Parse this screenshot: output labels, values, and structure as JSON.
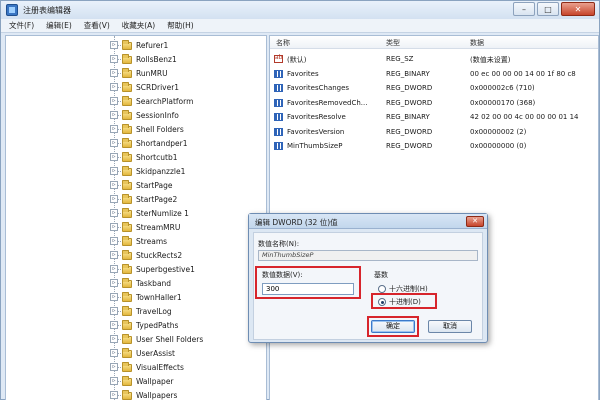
{
  "window": {
    "title": "注册表编辑器",
    "controls": {
      "minimize": "–",
      "maximize": "□",
      "close": "✕"
    }
  },
  "menu": [
    "文件(F)",
    "编辑(E)",
    "查看(V)",
    "收藏夹(A)",
    "帮助(H)"
  ],
  "tree": {
    "items": [
      "Refurer1",
      "RollsBenz1",
      "RunMRU",
      "SCRDriver1",
      "SearchPlatform",
      "SessionInfo",
      "Shell Folders",
      "Shortandper1",
      "Shortcutb1",
      "Skidpanzzle1",
      "StartPage",
      "StartPage2",
      "SterNumlize 1",
      "StreamMRU",
      "Streams",
      "StuckRects2",
      "Superbgestive1",
      "Taskband",
      "TownHaller1",
      "TravelLog",
      "TypedPaths",
      "User Shell Folders",
      "UserAssist",
      "VisualEffects",
      "Wallpaper",
      "Wallpapers"
    ]
  },
  "values": {
    "columns": {
      "name": "名称",
      "type": "类型",
      "data": "数据"
    },
    "rows": [
      {
        "name": "(默认)",
        "type": "REG_SZ",
        "data": "(数值未设置)",
        "icon": "string-value-icon"
      },
      {
        "name": "Favorites",
        "type": "REG_BINARY",
        "data": "00 ec 00 00 00 14 00 1f 80 c8",
        "icon": "binary-value-icon"
      },
      {
        "name": "FavoritesChanges",
        "type": "REG_DWORD",
        "data": "0x000002c6 (710)",
        "icon": "binary-value-icon"
      },
      {
        "name": "FavoritesRemovedCh...",
        "type": "REG_DWORD",
        "data": "0x00000170 (368)",
        "icon": "binary-value-icon"
      },
      {
        "name": "FavoritesResolve",
        "type": "REG_BINARY",
        "data": "42 02 00 00 4c 00 00 00 01 14",
        "icon": "binary-value-icon"
      },
      {
        "name": "FavoritesVersion",
        "type": "REG_DWORD",
        "data": "0x00000002 (2)",
        "icon": "binary-value-icon"
      },
      {
        "name": "MinThumbSizeP",
        "type": "REG_DWORD",
        "data": "0x00000000 (0)",
        "icon": "binary-value-icon"
      }
    ]
  },
  "dialog": {
    "title": "编辑 DWORD (32 位)值",
    "close": "✕",
    "name_label": "数值名称(N):",
    "name_value": "MinThumbSizeP",
    "data_label": "数值数据(V):",
    "data_value": "300",
    "base_label": "基数",
    "radio_hex": "十六进制(H)",
    "radio_dec": "十进制(D)",
    "selected_base": "decimal",
    "ok": "确定",
    "cancel": "取消"
  },
  "colors": {
    "highlight": "#d7252c",
    "window_bg": "#dfe9f5",
    "folder": "#e2b73d"
  }
}
